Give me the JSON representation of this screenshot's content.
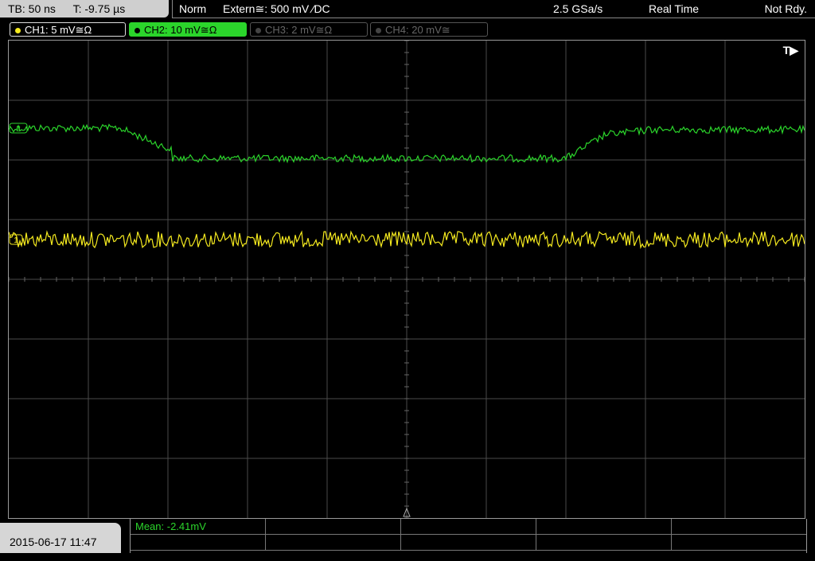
{
  "top": {
    "timebase": "TB: 50 ns",
    "trigger_time": "T: -9.75 µs",
    "mode": "Norm",
    "trigger_source": "Extern≅: 500 mV ⁄DC",
    "sample_rate": "2.5 GSa/s",
    "acq_mode": "Real Time",
    "trigger_status": "Not Rdy."
  },
  "channels": [
    {
      "label": "CH1: 5 mV≅Ω",
      "color": "#f5ea1f",
      "active": true
    },
    {
      "label": "CH2: 10 mV≅Ω",
      "color": "#2bd52b",
      "active": true,
      "selected": true
    },
    {
      "label": "CH3: 2 mV≅Ω",
      "color": "#666666",
      "active": false
    },
    {
      "label": "CH4: 20 mV≅",
      "color": "#666666",
      "active": false
    }
  ],
  "display": {
    "trigger_marker": "T▶",
    "ch1_marker": "1",
    "ch2_marker": "2",
    "grid_divisions": {
      "x": 10,
      "y": 8
    }
  },
  "footer": {
    "datetime": "2015-06-17 11:47",
    "measurement": "Mean: -2.41mV"
  },
  "colors": {
    "ch1": "#f5ea1f",
    "ch2": "#2bd52b",
    "grid": "#4a4a4a"
  }
}
